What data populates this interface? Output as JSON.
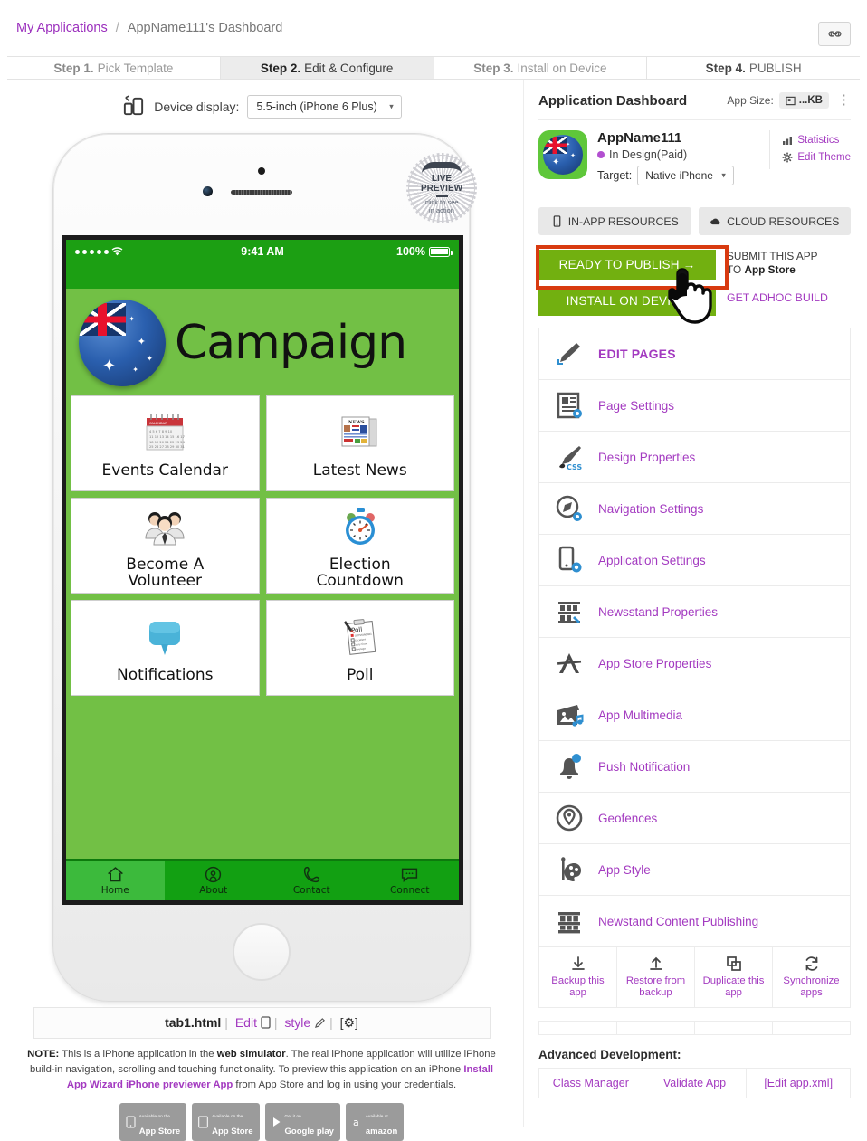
{
  "breadcrumb": {
    "root": "My Applications",
    "separator": "/",
    "current": "AppName111's Dashboard",
    "link_icon": "link-icon"
  },
  "steps": [
    {
      "num": "Step 1.",
      "label": "Pick Template",
      "active": false
    },
    {
      "num": "Step 2.",
      "label": "Edit & Configure",
      "active": true
    },
    {
      "num": "Step 3.",
      "label": "Install on Device",
      "active": false
    },
    {
      "num": "Step 4.",
      "label": "PUBLISH",
      "active": false
    }
  ],
  "device": {
    "label": "Device display:",
    "selected": "5.5-inch (iPhone 6 Plus)",
    "icon": "device-switch-icon"
  },
  "live_preview": {
    "line1": "LIVE",
    "line2": "PREVIEW",
    "sub1": "click to see",
    "sub2": "in action"
  },
  "phone": {
    "status": {
      "time": "9:41 AM",
      "battery": "100%"
    },
    "app_title": "Campaign",
    "tiles": [
      {
        "label": "Events Calendar",
        "icon": "calendar-icon"
      },
      {
        "label": "Latest News",
        "icon": "newspaper-icon"
      },
      {
        "label": "Become A\nVolunteer",
        "icon": "people-group-icon"
      },
      {
        "label": "Election\nCountdown",
        "icon": "stopwatch-icon"
      },
      {
        "label": "Notifications",
        "icon": "speech-bubble-icon"
      },
      {
        "label": "Poll",
        "icon": "clipboard-poll-icon"
      }
    ],
    "tabs": [
      {
        "label": "Home",
        "icon": "home-icon",
        "selected": true
      },
      {
        "label": "About",
        "icon": "person-icon",
        "selected": false
      },
      {
        "label": "Contact",
        "icon": "phone-icon",
        "selected": false
      },
      {
        "label": "Connect",
        "icon": "chat-icon",
        "selected": false
      }
    ],
    "colors": {
      "status_bar": "#1c9f13",
      "screen_bg": "#72c045",
      "tabbar": "#12a012",
      "tab_selected": "#3cba3c"
    }
  },
  "file_bar": {
    "filename": "tab1.html",
    "edit": "Edit",
    "style": "style",
    "gear": "[⚙]",
    "sep": "|"
  },
  "note": {
    "prefix": "NOTE:",
    "text1": " This is a iPhone application in the ",
    "bold1": "web simulator",
    "text2": ". The real iPhone application will utilize iPhone build-in navigation, scrolling and touching functionality. To preview this application on an iPhone ",
    "link": "Install App Wizard iPhone previewer App",
    "text3": " from App Store and log in using your credentials."
  },
  "store_badges": [
    {
      "small": "Available on the",
      "big": "App Store",
      "icon": "iphone-icon"
    },
    {
      "small": "Available on the",
      "big": "App Store",
      "icon": "ipad-icon"
    },
    {
      "small": "Get it on",
      "big": "Google play",
      "icon": "play-icon"
    },
    {
      "small": "Available at",
      "big": "amazon",
      "icon": "amazon-a-icon"
    }
  ],
  "panel": {
    "title": "Application Dashboard",
    "app_size_label": "App Size:",
    "app_size_value": "...KB",
    "kebab": "⋮",
    "app": {
      "name": "AppName111",
      "status": "In Design(Paid)",
      "status_color": "#b24fd0",
      "target_label": "Target:",
      "target_value": "Native iPhone"
    },
    "side_links": [
      {
        "label": "Statistics",
        "icon": "bar-chart-icon"
      },
      {
        "label": "Edit Theme",
        "icon": "gear-icon"
      }
    ],
    "resource_buttons": [
      {
        "label": "IN-APP RESOURCES",
        "icon": "phone-icon"
      },
      {
        "label": "CLOUD RESOURCES",
        "icon": "cloud-icon"
      }
    ],
    "publish": {
      "ready_label": "READY TO PUBLISH →",
      "install_label": "INSTALL ON DEVICE",
      "submit_line1": "SUBMIT THIS APP",
      "submit_line2_pre": "TO ",
      "submit_line2_bold": "App Store",
      "adhoc": "GET ADHOC BUILD",
      "highlight_color": "#d83a10",
      "button_color": "#72b010"
    },
    "menu": [
      {
        "label": "EDIT PAGES",
        "icon": "pencil-icon"
      },
      {
        "label": "Page Settings",
        "icon": "page-settings-icon"
      },
      {
        "label": "Design Properties",
        "icon": "css-brush-icon"
      },
      {
        "label": "Navigation Settings",
        "icon": "compass-gear-icon"
      },
      {
        "label": "Application Settings",
        "icon": "phone-gear-icon"
      },
      {
        "label": "Newsstand Properties",
        "icon": "shelf-wrench-icon"
      },
      {
        "label": "App Store Properties",
        "icon": "appstore-a-icon"
      },
      {
        "label": "App Multimedia",
        "icon": "multimedia-icon"
      },
      {
        "label": "Push Notification",
        "icon": "bell-icon"
      },
      {
        "label": "Geofences",
        "icon": "geofence-icon"
      },
      {
        "label": "App Style",
        "icon": "palette-icon"
      },
      {
        "label": "Newstand Content Publishing",
        "icon": "shelf-icon"
      }
    ],
    "tools": [
      {
        "label": "Backup this app",
        "icon": "download-icon"
      },
      {
        "label": "Restore from backup",
        "icon": "upload-icon"
      },
      {
        "label": "Duplicate this app",
        "icon": "copy-icon"
      },
      {
        "label": "Synchronize apps",
        "icon": "sync-icon"
      }
    ],
    "advanced": {
      "title": "Advanced Development:",
      "buttons": [
        "Class Manager",
        "Validate App",
        "[Edit app.xml]"
      ]
    }
  }
}
